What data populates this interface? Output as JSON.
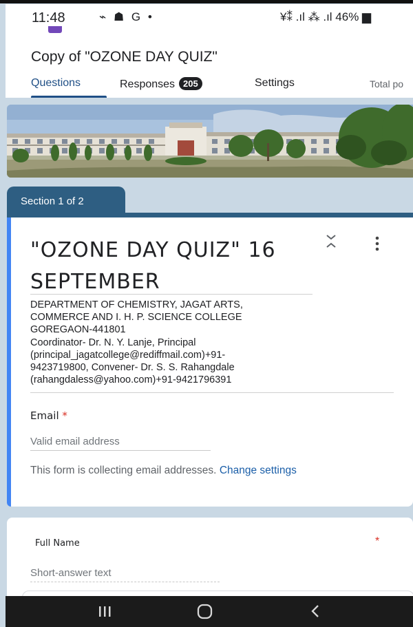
{
  "status_bar": {
    "time": "11:48",
    "icons_left": "⌁ ☗ G •",
    "icons_right": "¥⁑ .ıl ⁂ .ıl 46% ▆"
  },
  "header": {
    "title": "Copy of  \"OZONE DAY QUIZ\"",
    "tabs": [
      {
        "label": "Questions",
        "active": true
      },
      {
        "label": "Responses",
        "badge": "205"
      },
      {
        "label": "Settings"
      },
      {
        "label": "Total po"
      }
    ]
  },
  "section": {
    "label": "Section 1 of 2"
  },
  "form": {
    "title": "\"OZONE DAY QUIZ\" 16 SEPTEMBER",
    "description_lines": [
      "DEPARTMENT OF CHEMISTRY, JAGAT ARTS,",
      "COMMERCE AND I. H. P. SCIENCE COLLEGE",
      "GOREGAON-441801",
      "Coordinator- Dr. N. Y. Lanje, Principal",
      "(principal_jagatcollege@rediffmail.com)+91-",
      "9423719800, Convener- Dr. S. S. Rahangdale",
      "(rahangdaless@yahoo.com)+91-9421796391"
    ],
    "email_label": "Email",
    "required_mark": "*",
    "email_placeholder": "Valid email address",
    "collect_note": "This form is collecting email addresses.",
    "change_settings_link": "Change settings"
  },
  "question": {
    "label": "Full Name",
    "required_mark": "*",
    "placeholder": "Short-answer text"
  },
  "icons": {
    "collapse": "collapse-icon",
    "more": "more-vert-icon",
    "recent_apps": "recent-apps-icon",
    "home": "home-icon",
    "back": "back-icon"
  },
  "colors": {
    "accent_blue": "#4285f4",
    "section_tab": "#2e5e82",
    "tab_active": "#1f4f86",
    "link": "#1a5ea8",
    "required": "#d93025",
    "page_bg": "#c9d8e4"
  }
}
